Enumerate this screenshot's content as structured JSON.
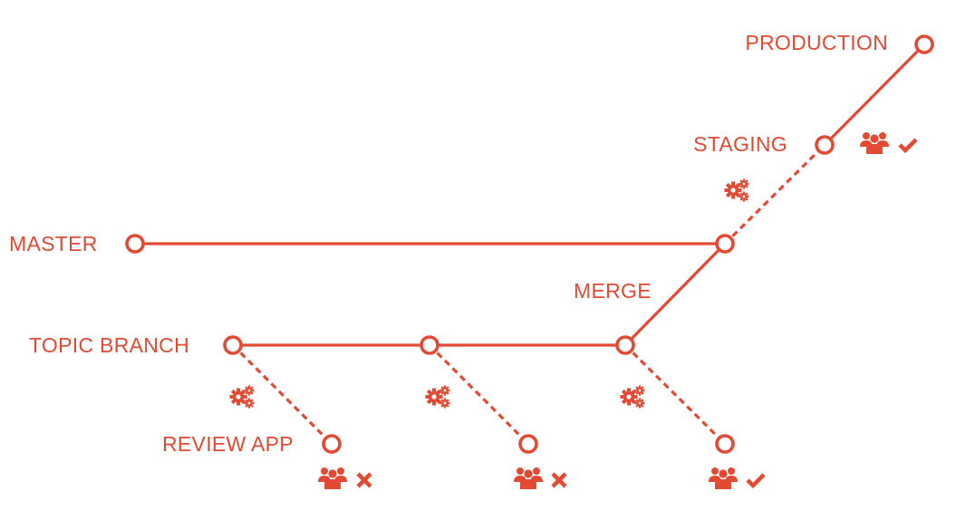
{
  "diagram": {
    "type": "git-flow",
    "accent_color": "#E24A33",
    "stages": {
      "production": "PRODUCTION",
      "staging": "STAGING",
      "master": "MASTER",
      "merge": "MERGE",
      "topic_branch": "TOPIC BRANCH",
      "review_app": "REVIEW APP"
    },
    "review_results": [
      {
        "reviewer_icon": "users-icon",
        "status_icon": "x-icon",
        "status": "rejected"
      },
      {
        "reviewer_icon": "users-icon",
        "status_icon": "x-icon",
        "status": "rejected"
      },
      {
        "reviewer_icon": "users-icon",
        "status_icon": "check-icon",
        "status": "approved"
      }
    ],
    "staging_result": {
      "reviewer_icon": "users-icon",
      "status_icon": "check-icon",
      "status": "approved"
    },
    "ci_icons": [
      "gears-icon",
      "gears-icon",
      "gears-icon",
      "gears-icon"
    ]
  }
}
